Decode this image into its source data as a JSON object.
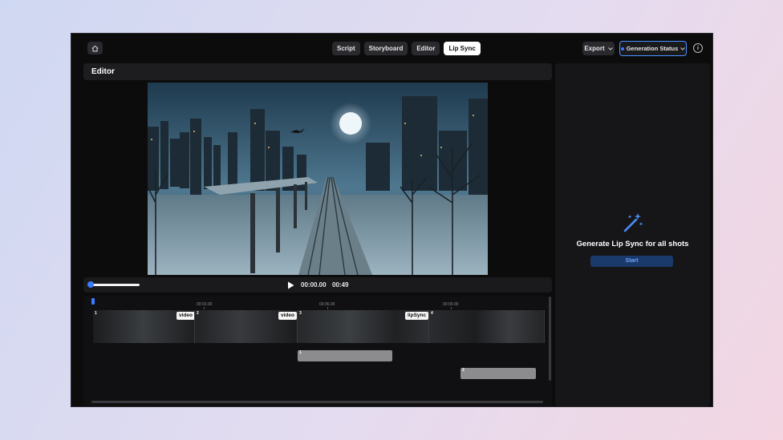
{
  "topbar": {
    "tabs": [
      {
        "label": "Script",
        "active": false
      },
      {
        "label": "Storyboard",
        "active": false
      },
      {
        "label": "Editor",
        "active": false
      },
      {
        "label": "Lip Sync",
        "active": true
      }
    ],
    "export_label": "Export",
    "generation_status_label": "Generation Status",
    "icons": {
      "home": "home-icon",
      "info": "info-icon"
    }
  },
  "editor": {
    "title": "Editor"
  },
  "player": {
    "current_time": "00:00.00",
    "total_time": "00:49"
  },
  "timeline": {
    "ruler": [
      "00:03.00",
      "00:06.00",
      "00:09.00"
    ],
    "video_clips": [
      {
        "number": "1",
        "tag": "video"
      },
      {
        "number": "2",
        "tag": "video"
      },
      {
        "number": "3",
        "tag": "lipSync"
      },
      {
        "number": "4",
        "tag": ""
      }
    ],
    "audio_clips": [
      {
        "number": "1"
      },
      {
        "number": "2"
      }
    ]
  },
  "lip_sync_panel": {
    "title": "Generate Lip Sync for all shots",
    "start_label": "Start"
  },
  "colors": {
    "accent": "#3a7bff",
    "background": "#0c0c0d"
  }
}
